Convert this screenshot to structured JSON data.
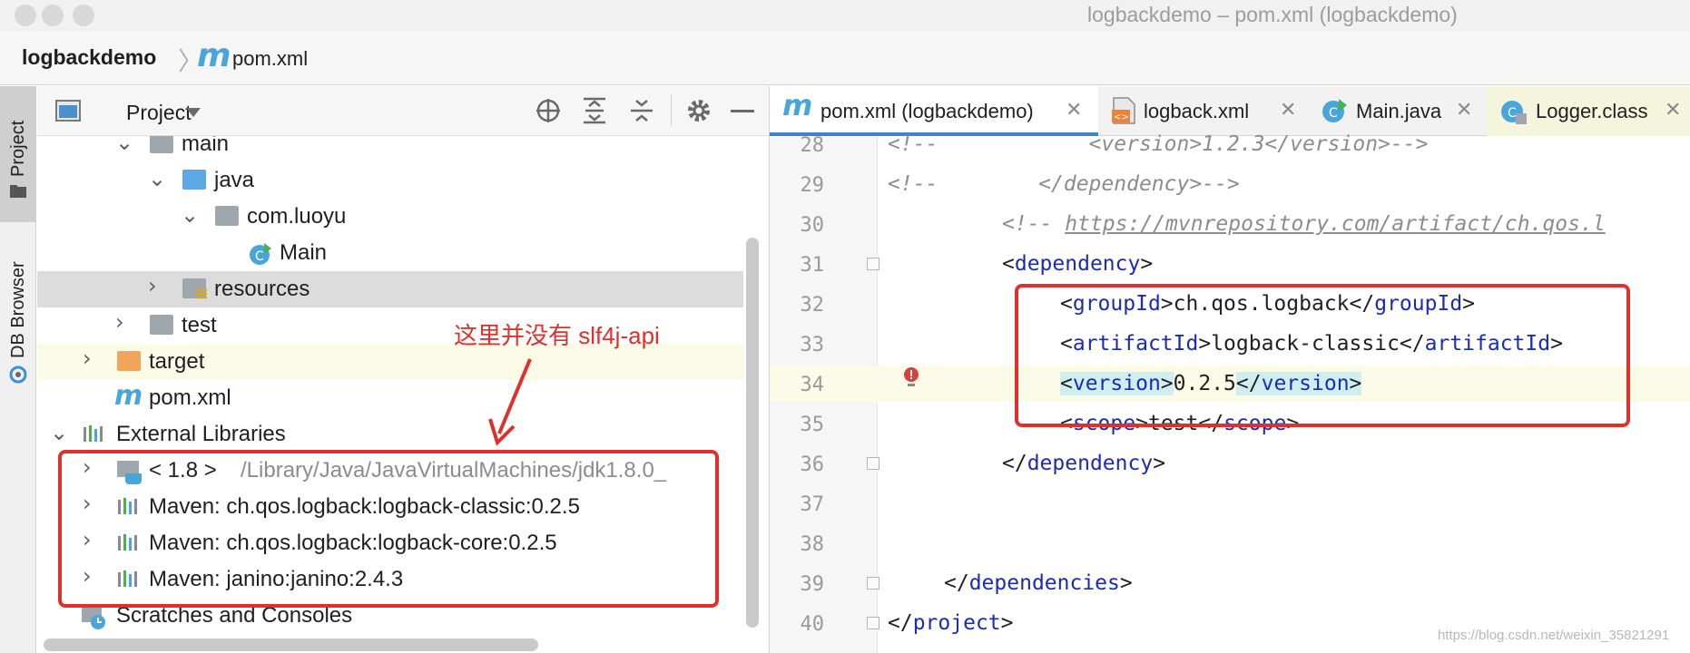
{
  "window": {
    "title": "logbackdemo – pom.xml (logbackdemo)"
  },
  "breadcrumb": {
    "project": "logbackdemo",
    "file_icon": "m",
    "file": "pom.xml"
  },
  "toolstrip": {
    "project_tab": "Project",
    "db_tab": "DB Browser"
  },
  "project_panel": {
    "title": "Project",
    "tree": [
      {
        "label": "main",
        "icon": "folder-icon",
        "expanded": true
      },
      {
        "label": "java",
        "icon": "source-folder-icon",
        "expanded": true
      },
      {
        "label": "com.luoyu",
        "icon": "package-icon",
        "expanded": true
      },
      {
        "label": "Main",
        "icon": "java-class-icon"
      },
      {
        "label": "resources",
        "icon": "resources-folder-icon",
        "expanded": false,
        "selected": true
      },
      {
        "label": "test",
        "icon": "folder-icon",
        "expanded": false
      },
      {
        "label": "target",
        "icon": "excluded-folder-icon",
        "expanded": false,
        "highlighted": true
      },
      {
        "label": "pom.xml",
        "icon": "maven-icon"
      },
      {
        "label": "External Libraries",
        "icon": "library-icon",
        "expanded": true
      },
      {
        "label": "< 1.8 >",
        "sub": "/Library/Java/JavaVirtualMachines/jdk1.8.0_",
        "icon": "jdk-icon",
        "expanded": false
      },
      {
        "label": "Maven: ch.qos.logback:logback-classic:0.2.5",
        "icon": "library-icon",
        "expanded": false
      },
      {
        "label": "Maven: ch.qos.logback:logback-core:0.2.5",
        "icon": "library-icon",
        "expanded": false
      },
      {
        "label": "Maven: janino:janino:2.4.3",
        "icon": "library-icon",
        "expanded": false
      },
      {
        "label": "Scratches and Consoles",
        "icon": "scratches-icon"
      }
    ]
  },
  "annotation": {
    "text": "这里并没有 slf4j-api"
  },
  "editor": {
    "tabs": [
      {
        "label": "pom.xml (logbackdemo)",
        "icon": "maven-icon",
        "active": true
      },
      {
        "label": "logback.xml",
        "icon": "xml-icon"
      },
      {
        "label": "Main.java",
        "icon": "java-class-icon"
      },
      {
        "label": "Logger.class",
        "icon": "class-icon"
      }
    ],
    "line_numbers": [
      "28",
      "29",
      "30",
      "31",
      "32",
      "33",
      "34",
      "35",
      "36",
      "37",
      "38",
      "39",
      "40"
    ],
    "code": {
      "l28": "<!--            <version>1.2.3</version>-->",
      "l29": "<!--        </dependency>-->",
      "l30_prefix": "<!-- ",
      "l30_link": "https://mvnrepository.com/artifact/ch.qos.l",
      "l31_tag": "dependency",
      "l32_tag": "groupId",
      "l32_value": "ch.qos.logback",
      "l33_tag": "artifactId",
      "l33_value": "logback-classic",
      "l34_tag": "version",
      "l34_value": "0.2.5",
      "l35_tag": "scope",
      "l35_value": "test",
      "l36_tag": "dependency",
      "l39_tag": "dependencies",
      "l40_tag": "project"
    }
  },
  "watermark": "https://blog.csdn.net/weixin_35821291",
  "colors": {
    "accent": "#4083c9",
    "annotation": "#e0302b",
    "xml_tag": "#1a2bb4",
    "comment": "#8c8c8c"
  }
}
